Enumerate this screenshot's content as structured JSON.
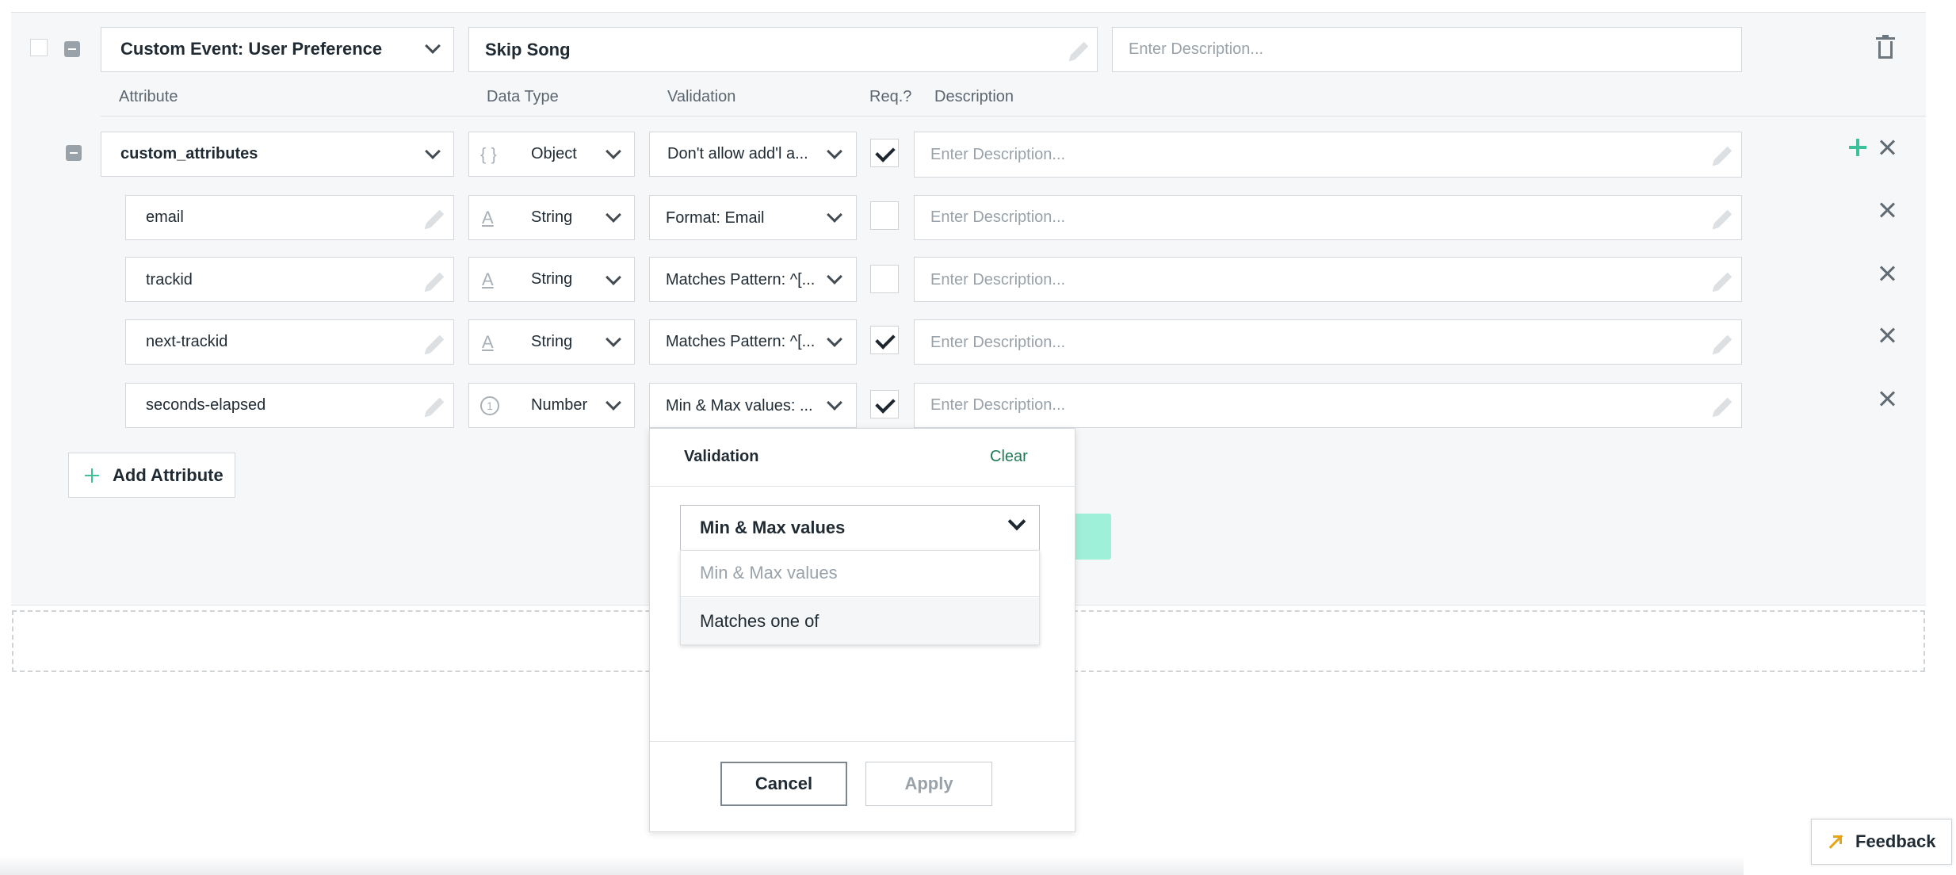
{
  "event": {
    "name": "Custom Event: User Preference",
    "title": "Skip Song",
    "description_placeholder": "Enter Description..."
  },
  "headers": {
    "attribute": "Attribute",
    "data_type": "Data Type",
    "validation": "Validation",
    "required": "Req.?",
    "description": "Description"
  },
  "rows": [
    {
      "name": "custom_attributes",
      "type": "Object",
      "type_icon": "{ }",
      "validation": "Don't allow add'l a...",
      "required": true,
      "description_placeholder": "Enter Description..."
    },
    {
      "name": "email",
      "type": "String",
      "type_icon": "A",
      "validation": "Format: Email",
      "required": false,
      "description_placeholder": "Enter Description..."
    },
    {
      "name": "trackid",
      "type": "String",
      "type_icon": "A",
      "validation": "Matches Pattern: ^[...",
      "required": false,
      "description_placeholder": "Enter Description..."
    },
    {
      "name": "next-trackid",
      "type": "String",
      "type_icon": "A",
      "validation": "Matches Pattern: ^[...",
      "required": true,
      "description_placeholder": "Enter Description..."
    },
    {
      "name": "seconds-elapsed",
      "type": "Number",
      "type_icon": "1",
      "validation": "Min & Max values: ...",
      "required": true,
      "description_placeholder": "Enter Description..."
    }
  ],
  "add_attribute_label": "Add Attribute",
  "popup": {
    "title": "Validation",
    "clear_label": "Clear",
    "selected": "Min & Max values",
    "options": [
      "Min & Max values",
      "Matches one of"
    ],
    "cancel_label": "Cancel",
    "apply_label": "Apply"
  },
  "feedback_label": "Feedback",
  "colors": {
    "accent": "#3cc29a",
    "accent_light": "#9ff0d8",
    "link": "#1f7a55"
  }
}
